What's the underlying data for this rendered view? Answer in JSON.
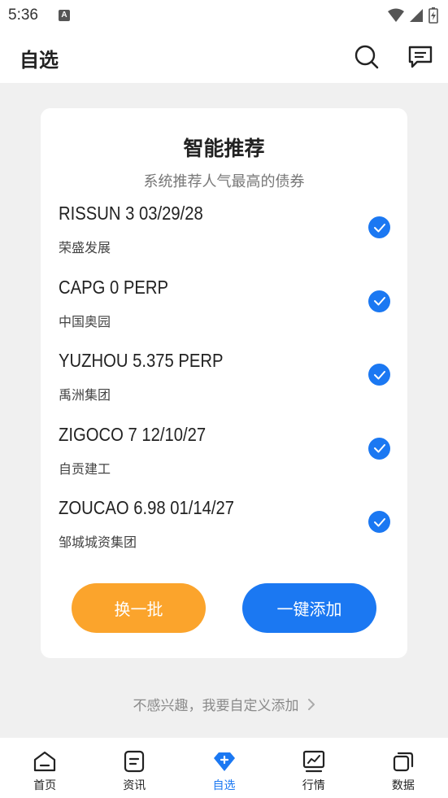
{
  "status_bar": {
    "time": "5:36",
    "notif_letter": "A"
  },
  "header": {
    "title": "自选",
    "icons": [
      "search-icon",
      "message-icon"
    ]
  },
  "recommend": {
    "title": "智能推荐",
    "subtitle": "系统推荐人气最高的债券",
    "bonds": [
      {
        "name": "RISSUN 3 03/29/28",
        "issuer": "荣盛发展",
        "checked": true
      },
      {
        "name": "CAPG 0 PERP",
        "issuer": "中国奥园",
        "checked": true
      },
      {
        "name": "YUZHOU 5.375 PERP",
        "issuer": "禹洲集团",
        "checked": true
      },
      {
        "name": "ZIGOCO 7 12/10/27",
        "issuer": "自贡建工",
        "checked": true
      },
      {
        "name": "ZOUCAO 6.98 01/14/27",
        "issuer": "邹城城资集团",
        "checked": true
      }
    ],
    "swap_label": "换一批",
    "add_all_label": "一键添加"
  },
  "custom_link": "不感兴趣，我要自定义添加",
  "tabs": [
    {
      "label": "首页",
      "icon": "home-icon",
      "active": false
    },
    {
      "label": "资讯",
      "icon": "news-icon",
      "active": false
    },
    {
      "label": "自选",
      "icon": "diamond-icon",
      "active": true
    },
    {
      "label": "行情",
      "icon": "chart-icon",
      "active": false
    },
    {
      "label": "数据",
      "icon": "data-icon",
      "active": false
    }
  ],
  "colors": {
    "accent": "#1b78f2",
    "orange": "#fba42c",
    "background": "#f0f0f0"
  }
}
